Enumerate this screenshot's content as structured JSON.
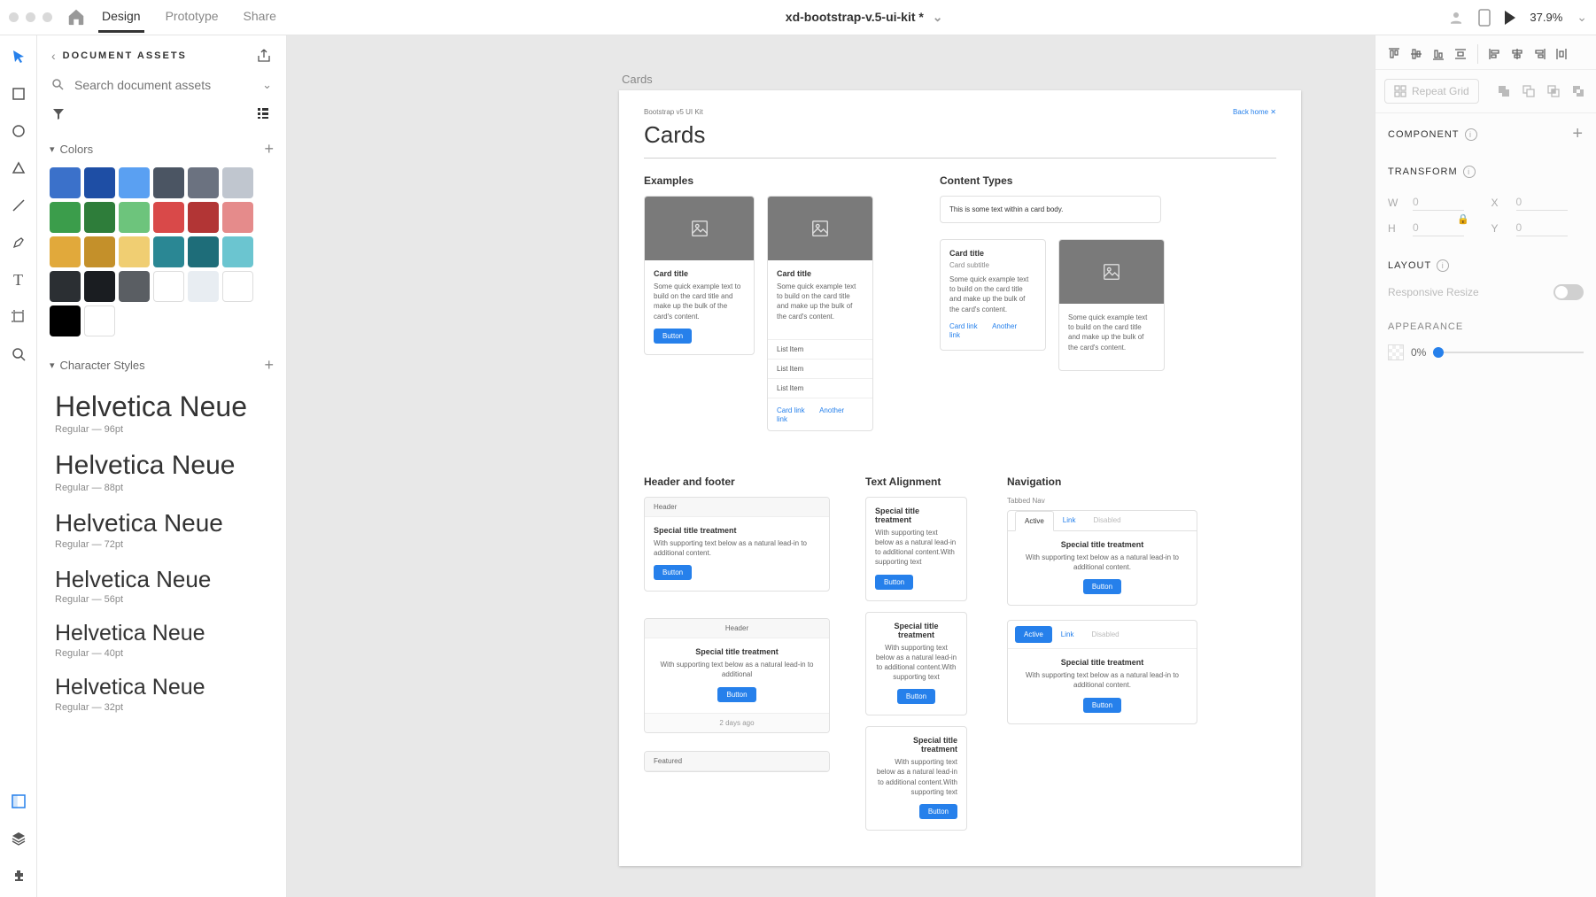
{
  "topbar": {
    "tabs": {
      "design": "Design",
      "prototype": "Prototype",
      "share": "Share"
    },
    "title": "xd-bootstrap-v.5-ui-kit *",
    "zoom": "37.9%"
  },
  "assets": {
    "heading": "DOCUMENT ASSETS",
    "search_placeholder": "Search document assets",
    "sections": {
      "colors": "Colors",
      "charstyles": "Character Styles"
    },
    "colors": [
      "#3b71ca",
      "#1e4ea5",
      "#5aa0f2",
      "#4b5563",
      "#6b7280",
      "#c0c6cf",
      "#3b9d4b",
      "#2e7d3a",
      "#6dc47c",
      "#d94949",
      "#b23535",
      "#e58b8b",
      "#e1a93b",
      "#c4902a",
      "#f0ce72",
      "#2a8794",
      "#1e6d79",
      "#6bc5d0",
      "#2b2f33",
      "#1a1d21",
      "#5a5e63",
      "#ffffff",
      "#e8edf2",
      "#ffffff",
      "#000000",
      "#ffffff"
    ],
    "charstyles": [
      {
        "name": "Helvetica Neue",
        "meta": "Regular — 96pt",
        "size": 32
      },
      {
        "name": "Helvetica Neue",
        "meta": "Regular — 88pt",
        "size": 30
      },
      {
        "name": "Helvetica Neue",
        "meta": "Regular — 72pt",
        "size": 28
      },
      {
        "name": "Helvetica Neue",
        "meta": "Regular — 56pt",
        "size": 26
      },
      {
        "name": "Helvetica Neue",
        "meta": "Regular — 40pt",
        "size": 25
      },
      {
        "name": "Helvetica Neue",
        "meta": "Regular — 32pt",
        "size": 25
      }
    ]
  },
  "artboard": {
    "label": "Cards",
    "kit": "Bootstrap v5 UI Kit",
    "backhome": "Back home  ✕",
    "title": "Cards",
    "examples": {
      "heading": "Examples",
      "card1": {
        "title": "Card title",
        "text": "Some quick example text to build on the card title and make up the bulk of the card's content.",
        "button": "Button"
      },
      "card2": {
        "title": "Card title",
        "text": "Some quick example text to build on the card title and make up the bulk of the card's content.",
        "list": [
          "List Item",
          "List Item",
          "List Item"
        ],
        "link1": "Card link",
        "link2": "Another link"
      }
    },
    "content": {
      "heading": "Content Types",
      "body_only": "This is some text within a card body.",
      "card3": {
        "title": "Card title",
        "subtitle": "Card subtitle",
        "text": "Some quick example text to build on the card title and make up the bulk of the card's content.",
        "link1": "Card link",
        "link2": "Another link"
      },
      "img_card": {
        "text": "Some quick example text to build on the card title and make up the bulk of the card's content."
      }
    },
    "headerfooter": {
      "heading": "Header and footer",
      "c1": {
        "header": "Header",
        "title": "Special title treatment",
        "text": "With supporting text below as a natural lead-in to additional content.",
        "button": "Button"
      },
      "c2": {
        "header": "Header",
        "title": "Special title treatment",
        "text": "With supporting text below as a natural lead-in to additional",
        "button": "Button",
        "footer": "2 days ago"
      },
      "c3": {
        "header": "Featured"
      }
    },
    "textalign": {
      "heading": "Text Alignment",
      "c1": {
        "title": "Special title treatment",
        "text": "With supporting text below as a natural lead-in to additional content.With supporting text",
        "button": "Button"
      },
      "c2": {
        "title": "Special title treatment",
        "text": "With supporting text below as a natural lead-in to additional content.With supporting text",
        "button": "Button"
      },
      "c3": {
        "title": "Special title treatment",
        "text": "With supporting text below as a natural lead-in to additional content.With supporting text",
        "button": "Button"
      }
    },
    "nav": {
      "heading": "Navigation",
      "tabbed_label": "Tabbed Nav",
      "tabs": {
        "active": "Active",
        "link": "Link",
        "disabled": "Disabled"
      },
      "card": {
        "title": "Special title treatment",
        "text": "With supporting text below as a natural lead-in to additional content.",
        "button": "Button"
      }
    }
  },
  "rpanel": {
    "repeat": "Repeat Grid",
    "component": "COMPONENT",
    "transform": "TRANSFORM",
    "wh": {
      "w_label": "W",
      "h_label": "H",
      "x_label": "X",
      "y_label": "Y",
      "w": "0",
      "h": "0",
      "x": "0",
      "y": "0"
    },
    "layout": "LAYOUT",
    "responsive": "Responsive Resize",
    "appearance": "APPEARANCE",
    "opacity": "0%"
  }
}
